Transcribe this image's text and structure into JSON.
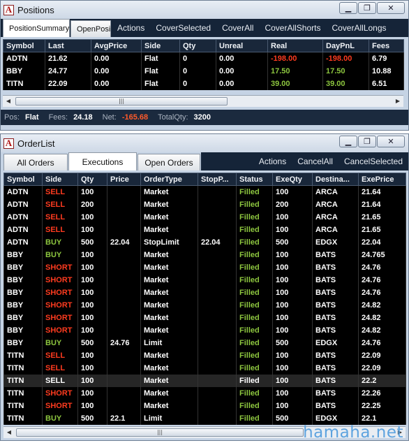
{
  "positions": {
    "title": "Positions",
    "tabs": [
      {
        "label": "PositionSummary",
        "active": true
      },
      {
        "label": "OpenPositi",
        "active": false
      }
    ],
    "actions": [
      "Actions",
      "CoverSelected",
      "CoverAll",
      "CoverAllShorts",
      "CoverAllLongs"
    ],
    "columns": [
      "Symbol",
      "Last",
      "AvgPrice",
      "Side",
      "Qty",
      "Unreal",
      "Real",
      "DayPnL",
      "Fees"
    ],
    "rows": [
      {
        "cells": [
          "ADTN",
          "21.62",
          "0.00",
          "Flat",
          "0",
          "0.00",
          "-198.00",
          "-198.00",
          "6.79"
        ],
        "colors": [
          "",
          "",
          "",
          "",
          "",
          "",
          "red",
          "red",
          ""
        ]
      },
      {
        "cells": [
          "BBY",
          "24.77",
          "0.00",
          "Flat",
          "0",
          "0.00",
          "17.50",
          "17.50",
          "10.88"
        ],
        "colors": [
          "",
          "",
          "",
          "",
          "",
          "",
          "green",
          "green",
          ""
        ]
      },
      {
        "cells": [
          "TITN",
          "22.09",
          "0.00",
          "Flat",
          "0",
          "0.00",
          "39.00",
          "39.00",
          "6.51"
        ],
        "colors": [
          "",
          "",
          "",
          "",
          "",
          "",
          "green",
          "green",
          ""
        ]
      }
    ],
    "status": {
      "pos_label": "Pos:",
      "pos_value": "Flat",
      "fees_label": "Fees:",
      "fees_value": "24.18",
      "net_label": "Net:",
      "net_value": "-165.68",
      "totalqty_label": "TotalQty:",
      "totalqty_value": "3200"
    }
  },
  "orderlist": {
    "title": "OrderList",
    "tabs": [
      {
        "label": "All Orders",
        "active": false
      },
      {
        "label": "Executions",
        "active": true
      },
      {
        "label": "Open Orders",
        "active": false
      }
    ],
    "actions": [
      "Actions",
      "CancelAll",
      "CancelSelected"
    ],
    "columns": [
      "Symbol",
      "Side",
      "Qty",
      "Price",
      "OrderType",
      "StopP...",
      "Status",
      "ExeQty",
      "Destina...",
      "ExePrice"
    ],
    "rows": [
      [
        "ADTN",
        "SELL",
        "100",
        "",
        "Market",
        "",
        "Filled",
        "100",
        "ARCA",
        "21.64"
      ],
      [
        "ADTN",
        "SELL",
        "200",
        "",
        "Market",
        "",
        "Filled",
        "200",
        "ARCA",
        "21.64"
      ],
      [
        "ADTN",
        "SELL",
        "100",
        "",
        "Market",
        "",
        "Filled",
        "100",
        "ARCA",
        "21.65"
      ],
      [
        "ADTN",
        "SELL",
        "100",
        "",
        "Market",
        "",
        "Filled",
        "100",
        "ARCA",
        "21.65"
      ],
      [
        "ADTN",
        "BUY",
        "500",
        "22.04",
        "StopLimit",
        "22.04",
        "Filled",
        "500",
        "EDGX",
        "22.04"
      ],
      [
        "BBY",
        "BUY",
        "100",
        "",
        "Market",
        "",
        "Filled",
        "100",
        "BATS",
        "24.765"
      ],
      [
        "BBY",
        "SHORT",
        "100",
        "",
        "Market",
        "",
        "Filled",
        "100",
        "BATS",
        "24.76"
      ],
      [
        "BBY",
        "SHORT",
        "100",
        "",
        "Market",
        "",
        "Filled",
        "100",
        "BATS",
        "24.76"
      ],
      [
        "BBY",
        "SHORT",
        "100",
        "",
        "Market",
        "",
        "Filled",
        "100",
        "BATS",
        "24.76"
      ],
      [
        "BBY",
        "SHORT",
        "100",
        "",
        "Market",
        "",
        "Filled",
        "100",
        "BATS",
        "24.82"
      ],
      [
        "BBY",
        "SHORT",
        "100",
        "",
        "Market",
        "",
        "Filled",
        "100",
        "BATS",
        "24.82"
      ],
      [
        "BBY",
        "SHORT",
        "100",
        "",
        "Market",
        "",
        "Filled",
        "100",
        "BATS",
        "24.82"
      ],
      [
        "BBY",
        "BUY",
        "500",
        "24.76",
        "Limit",
        "",
        "Filled",
        "500",
        "EDGX",
        "24.76"
      ],
      [
        "TITN",
        "SELL",
        "100",
        "",
        "Market",
        "",
        "Filled",
        "100",
        "BATS",
        "22.09"
      ],
      [
        "TITN",
        "SELL",
        "100",
        "",
        "Market",
        "",
        "Filled",
        "100",
        "BATS",
        "22.09"
      ],
      [
        "TITN",
        "SELL",
        "100",
        "",
        "Market",
        "",
        "Filled",
        "100",
        "BATS",
        "22.2"
      ],
      [
        "TITN",
        "SHORT",
        "100",
        "",
        "Market",
        "",
        "Filled",
        "100",
        "BATS",
        "22.26"
      ],
      [
        "TITN",
        "SHORT",
        "100",
        "",
        "Market",
        "",
        "Filled",
        "100",
        "BATS",
        "22.25"
      ],
      [
        "TITN",
        "BUY",
        "500",
        "22.1",
        "Limit",
        "",
        "Filled",
        "500",
        "EDGX",
        "22.1"
      ]
    ],
    "selected_row": 15
  },
  "colors": {
    "buy": "#8dc63f",
    "sell": "#ff3b1f",
    "filled": "#8dc63f",
    "negative": "#ff3b1f"
  },
  "watermark": "hamaha.net"
}
